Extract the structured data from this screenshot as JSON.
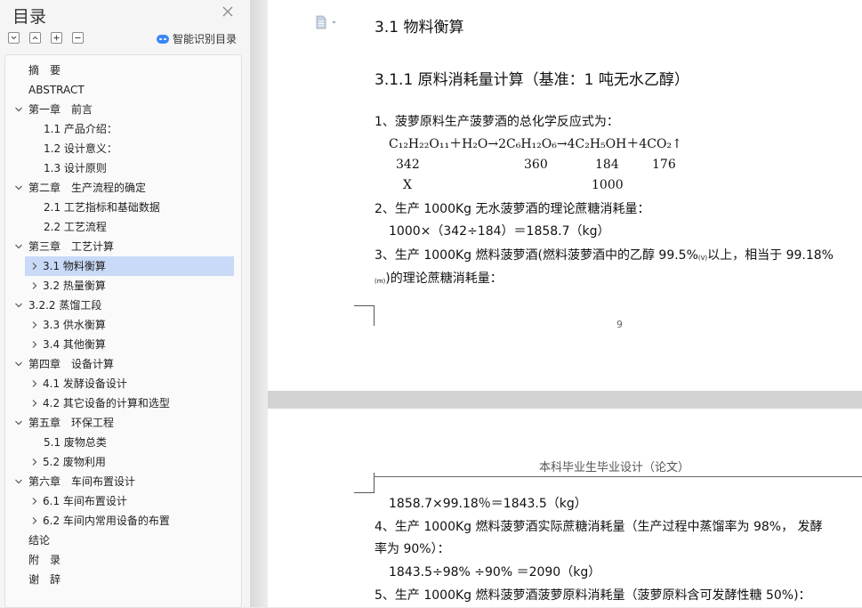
{
  "sidebar": {
    "title": "目录",
    "smart_toc_label": "智能识别目录",
    "toolbar_icons": [
      "collapse-all-icon",
      "expand-all-icon",
      "add-level-icon",
      "remove-level-icon"
    ],
    "items": [
      {
        "label": "摘　要",
        "level": 0,
        "arrow": "none"
      },
      {
        "label": "ABSTRACT",
        "level": 0,
        "arrow": "none"
      },
      {
        "label": "第一章　前言",
        "level": 0,
        "arrow": "down"
      },
      {
        "label": "1.1 产品介绍：",
        "level": 2,
        "arrow": "none"
      },
      {
        "label": "1.2 设计意义：",
        "level": 2,
        "arrow": "none"
      },
      {
        "label": "1.3  设计原则",
        "level": 2,
        "arrow": "none"
      },
      {
        "label": "第二章　生产流程的确定",
        "level": 0,
        "arrow": "down"
      },
      {
        "label": "2.1  工艺指标和基础数据",
        "level": 2,
        "arrow": "none"
      },
      {
        "label": "2.2  工艺流程",
        "level": 2,
        "arrow": "none"
      },
      {
        "label": "第三章　工艺计算",
        "level": 0,
        "arrow": "down"
      },
      {
        "label": "3.1 物料衡算",
        "level": 1,
        "arrow": "right",
        "selected": true
      },
      {
        "label": "3.2  热量衡算",
        "level": 1,
        "arrow": "right"
      },
      {
        "label": "3.2.2  蒸馏工段",
        "level": 0,
        "arrow": "down"
      },
      {
        "label": "3.3  供水衡算",
        "level": 1,
        "arrow": "right"
      },
      {
        "label": "3.4  其他衡算",
        "level": 1,
        "arrow": "right"
      },
      {
        "label": "第四章　设备计算",
        "level": 0,
        "arrow": "down"
      },
      {
        "label": "4.1 发酵设备设计",
        "level": 1,
        "arrow": "right"
      },
      {
        "label": "4.2 其它设备的计算和选型",
        "level": 1,
        "arrow": "right"
      },
      {
        "label": "第五章　环保工程",
        "level": 0,
        "arrow": "down"
      },
      {
        "label": "5.1  废物总类",
        "level": 2,
        "arrow": "none"
      },
      {
        "label": "5.2  废物利用",
        "level": 1,
        "arrow": "right"
      },
      {
        "label": "第六章　车间布置设计",
        "level": 0,
        "arrow": "down"
      },
      {
        "label": "6.1 车间布置设计",
        "level": 1,
        "arrow": "right"
      },
      {
        "label": "6.2 车间内常用设备的布置",
        "level": 1,
        "arrow": "right"
      },
      {
        "label": "结论",
        "level": 0,
        "arrow": "none"
      },
      {
        "label": "附　录",
        "level": 0,
        "arrow": "none"
      },
      {
        "label": "谢　辞",
        "level": 0,
        "arrow": "none"
      }
    ]
  },
  "document": {
    "page1": {
      "heading": "3.1 物料衡算",
      "subheading": "3.1.1  原料消耗量计算（基准：1 吨无水乙醇）",
      "line1": "1、菠萝原料生产菠萝酒的总化学反应式为：",
      "equation": "C₁₂H₂₂O₁₁＋H₂O→2C₆H₁₂O₆→4C₂H₅OH＋4CO₂↑",
      "mass_342": "342",
      "mass_360": "360",
      "mass_184": "184",
      "mass_176": "176",
      "mass_x": "X",
      "mass_1000": "1000",
      "line2": "2、生产 1000Kg 无水菠萝酒的理论蔗糖消耗量：",
      "calc1": "1000×（342÷184）＝1858.7（kg）",
      "line3": "3、生产 1000Kg 燃料菠萝酒(燃料菠萝酒中的乙醇 99.5%",
      "line3_sub1": "(V)",
      "line3_rest": "以上，相当于 99.18%",
      "line3b_sub": "(m)",
      "line3b": ")的理论蔗糖消耗量：",
      "page_number": "9"
    },
    "page2": {
      "header": "本科毕业生毕业设计（论文）",
      "calc2": "1858.7×99.18％＝1843.5（kg）",
      "line4": "4、生产 1000Kg 燃料菠萝酒实际蔗糖消耗量（生产过程中蒸馏率为 98%， 发酵",
      "line4b": "率为 90%）：",
      "calc3": "1843.5÷98% ÷90% ＝2090（kg）",
      "line5": "5、生产 1000Kg 燃料菠萝酒菠萝原料消耗量（菠萝原料含可发酵性糖 50%)："
    }
  },
  "colors": {
    "selection": "#c9daf8",
    "accent": "#3a86f5"
  }
}
